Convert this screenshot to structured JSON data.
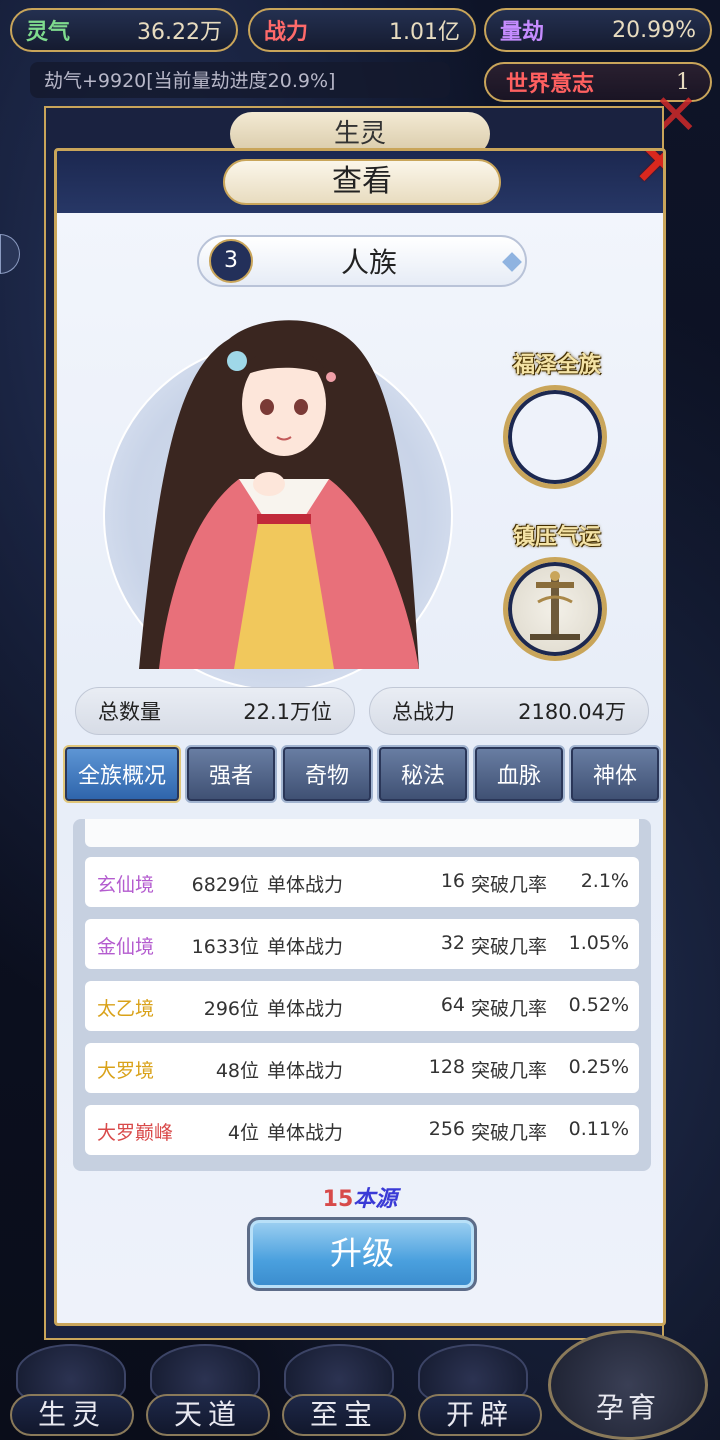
{
  "top_stats": [
    {
      "label": "灵气",
      "value": "36.22万"
    },
    {
      "label": "战力",
      "value": "1.01亿"
    },
    {
      "label": "量劫",
      "value": "20.99%"
    }
  ],
  "log_text": "劫气+9920[当前量劫进度20.9%]",
  "world_will": {
    "label": "世界意志",
    "value": "1"
  },
  "back_tab_label": "生灵",
  "modal": {
    "title": "查看",
    "race_index": "3",
    "race_name": "人族",
    "side_labels": {
      "blessing": "福泽全族",
      "suppress": "镇压气运"
    },
    "total_count": {
      "label": "总数量",
      "value": "22.1万位"
    },
    "total_power": {
      "label": "总战力",
      "value": "2180.04万"
    },
    "tabs": [
      "全族概况",
      "强者",
      "奇物",
      "秘法",
      "血脉",
      "神体"
    ],
    "realm_rows": [
      {
        "name": "玄仙境",
        "count": "6829位",
        "power_label": "单体战力",
        "power": "16",
        "rate_label": "突破几率",
        "rate": "2.1%",
        "color": "#b45ccf"
      },
      {
        "name": "金仙境",
        "count": "1633位",
        "power_label": "单体战力",
        "power": "32",
        "rate_label": "突破几率",
        "rate": "1.05%",
        "color": "#b45ccf"
      },
      {
        "name": "太乙境",
        "count": "296位",
        "power_label": "单体战力",
        "power": "64",
        "rate_label": "突破几率",
        "rate": "0.52%",
        "color": "#d9a21a"
      },
      {
        "name": "大罗境",
        "count": "48位",
        "power_label": "单体战力",
        "power": "128",
        "rate_label": "突破几率",
        "rate": "0.25%",
        "color": "#d9a21a"
      },
      {
        "name": "大罗巅峰",
        "count": "4位",
        "power_label": "单体战力",
        "power": "256",
        "rate_label": "突破几率",
        "rate": "0.11%",
        "color": "#d94a4a"
      }
    ],
    "cost": {
      "amount": "15",
      "unit": "本源"
    },
    "upgrade_label": "升级"
  },
  "bottom_nav": [
    "生灵",
    "天道",
    "至宝",
    "开辟",
    "孕育"
  ]
}
